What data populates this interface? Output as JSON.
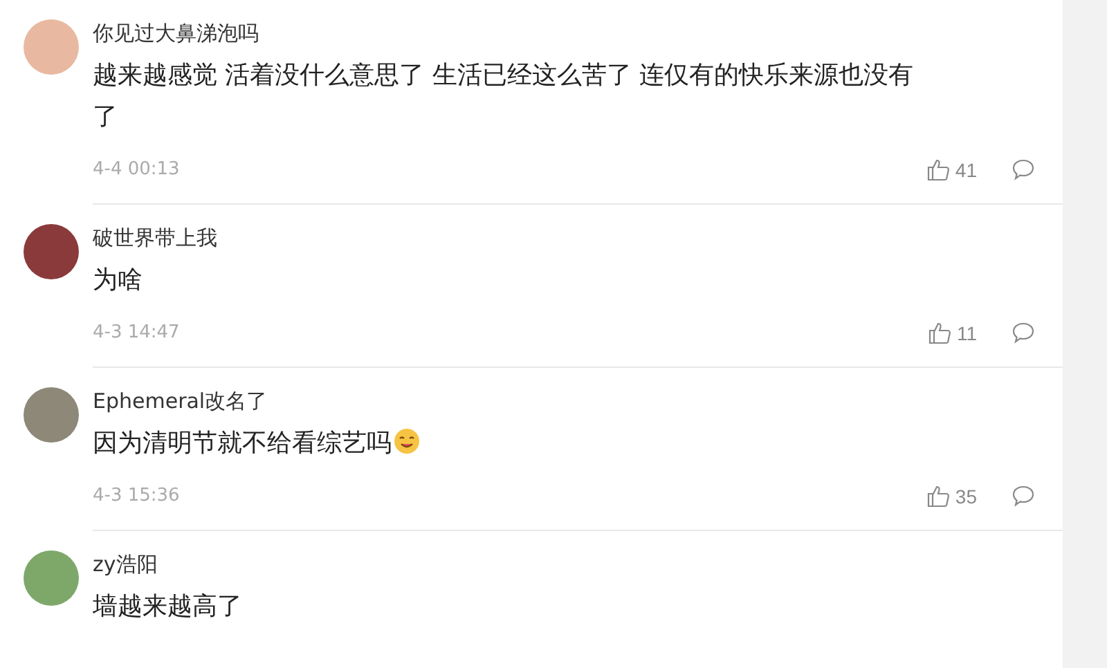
{
  "comments": [
    {
      "username": "你见过大鼻涕泡吗",
      "text": "越来越感觉 活着没什么意思了 生活已经这么苦了 连仅有的快乐来源也没有了",
      "time": "4-4 00:13",
      "likes": "41",
      "has_emoji": false
    },
    {
      "username": "破世界带上我",
      "text": "为啥",
      "time": "4-3 14:47",
      "likes": "11",
      "has_emoji": false
    },
    {
      "username": "Ephemeral改名了",
      "text": "因为清明节就不给看综艺吗",
      "time": "4-3 15:36",
      "likes": "35",
      "has_emoji": true
    },
    {
      "username": "zy浩阳",
      "text": "墙越来越高了",
      "has_emoji": false
    }
  ]
}
